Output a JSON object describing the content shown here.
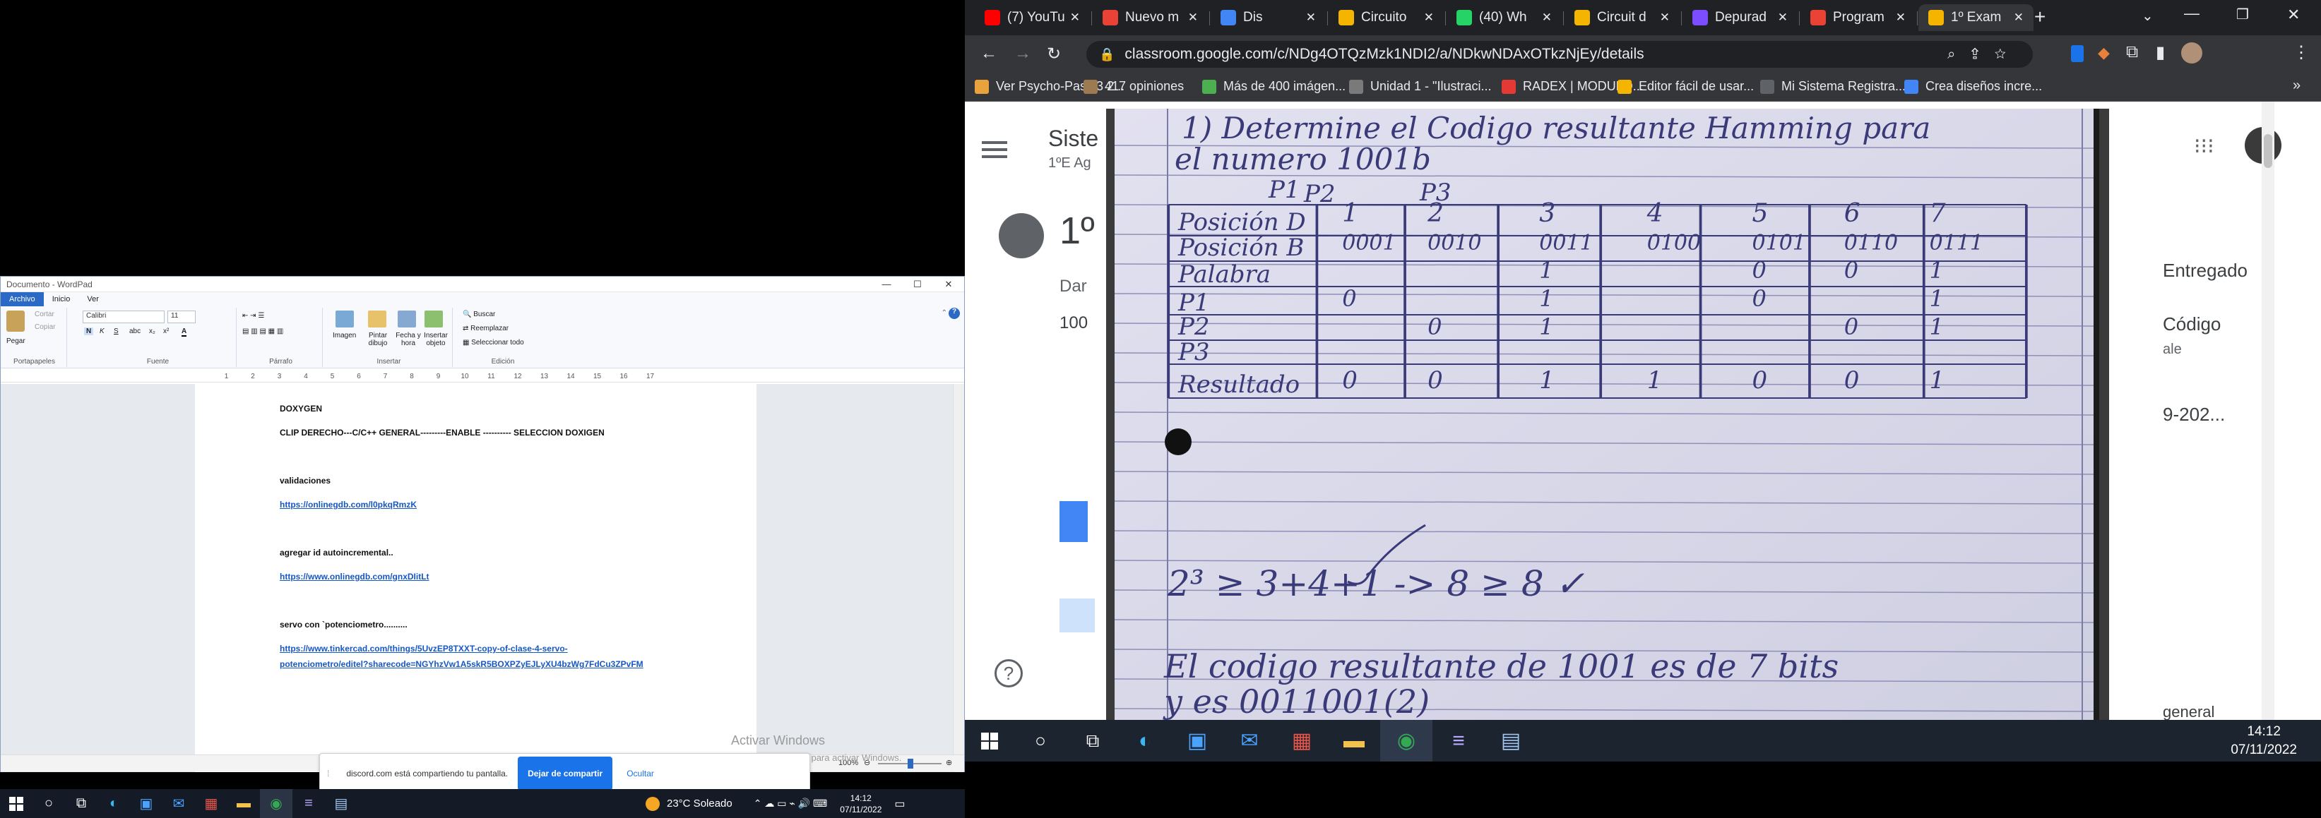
{
  "wordpad": {
    "title": "Documento - WordPad",
    "tabs": [
      "Archivo",
      "Inicio",
      "Ver"
    ],
    "ribbon": {
      "paste": "Pegar",
      "cut": "Cortar",
      "copy": "Copiar",
      "group_clipboard": "Portapapeles",
      "font_name": "Calibri",
      "font_size": "11",
      "group_font": "Fuente",
      "group_paragraph": "Párrafo",
      "image": "Imagen",
      "paint": "Pintar dibujo",
      "datetime": "Fecha y hora",
      "insert_object": "Insertar objeto",
      "group_insert": "Insertar",
      "find": "Buscar",
      "replace": "Reemplazar",
      "select_all": "Seleccionar todo",
      "group_edit": "Edición"
    },
    "ruler_numbers": [
      "1",
      "2",
      "3",
      "4",
      "5",
      "6",
      "7",
      "8",
      "9",
      "10",
      "11",
      "12",
      "13",
      "14",
      "15",
      "16",
      "17"
    ],
    "doc": {
      "l1": "DOXYGEN",
      "l2": "CLIP DERECHO---C/C++ GENERAL---------ENABLE    ----------  SELECCION DOXIGEN",
      "l3": "validaciones",
      "l4": "https://onlinegdb.com/l0pkqRmzK",
      "l5": "agregar id autoincremental..",
      "l6": "https://www.onlinegdb.com/gnxDIitLt",
      "l7": "servo con `potenciometro..........",
      "l8": "https://www.tinkercad.com/things/5UvzEP8TXXT-copy-of-clase-4-servo-",
      "l9": "potenciometro/editel?sharecode=NGYhzVw1A5skR5BOXPZyEJLyXU4bzWg7FdCu3ZPvFM"
    },
    "zoom": "100%"
  },
  "share_bar": {
    "text": "discord.com está compartiendo tu pantalla.",
    "stop": "Dejar de compartir",
    "hide": "Ocultar"
  },
  "activate": {
    "title": "Activar Windows",
    "sub": "Ve a Configuración para activar Windows."
  },
  "taskbar_left": {
    "weather": "23°C  Soleado",
    "time": "14:12",
    "date": "07/11/2022"
  },
  "chrome": {
    "tabs": [
      {
        "label": "(7) YouTu",
        "color": "#ff0000"
      },
      {
        "label": "Nuevo m",
        "color": "#ea4335"
      },
      {
        "label": "Dis",
        "color": "#4285f4"
      },
      {
        "label": "Circuito",
        "color": "#f4b400"
      },
      {
        "label": "(40) Wh",
        "color": "#25d366"
      },
      {
        "label": "Circuit d",
        "color": "#f4b400"
      },
      {
        "label": "Depurad",
        "color": "#7c4dff"
      },
      {
        "label": "Program",
        "color": "#ea4335"
      },
      {
        "label": "1º Exam",
        "color": "#f4b400"
      }
    ],
    "url": "classroom.google.com/c/NDg4OTQzMzk1NDI2/a/NDkwNDAxOTkzNjEy/details",
    "bookmarks": [
      "Ver Psycho-Pass 3 2...",
      "417 opiniones",
      "Más de 400 imágen...",
      "Unidad 1 - \"Ilustraci...",
      "RADEX | MODULO...",
      "Editor fácil de usar...",
      "Mi Sistema Registra...",
      "Crea diseños incre..."
    ]
  },
  "classroom_bg": {
    "left_title": "Siste",
    "left_sub": "1ºE Ag",
    "num": "1º",
    "dar": "Dar",
    "cien": "100",
    "entregado": "Entregado",
    "codigo": "Código",
    "ale": "ale",
    "year": "9-202...",
    "general": "general"
  },
  "sheet": {
    "title_line1": "1) Determine el Codigo resultante Hamming para",
    "title_line2": "el numero 1001b",
    "p1": "P1",
    "p2": "P2",
    "p3": "P3",
    "row_labels": [
      "Posición D",
      "Posición B",
      "Palabra",
      "P1",
      "P2",
      "P3",
      "Resultado"
    ],
    "posD": [
      "1",
      "2",
      "3",
      "4",
      "5",
      "6",
      "7"
    ],
    "posB": [
      "0001",
      "0010",
      "0011",
      "0100",
      "0101",
      "0110",
      "0111"
    ],
    "palabra": [
      "",
      "",
      "1",
      "",
      "0",
      "0",
      "1"
    ],
    "p1row": [
      "0",
      "",
      "1",
      "",
      "0",
      "",
      "1"
    ],
    "p2row": [
      "",
      "0",
      "1",
      "",
      "",
      "0",
      "1"
    ],
    "resultado": [
      "0",
      "0",
      "1",
      "1",
      "0",
      "0",
      "1"
    ],
    "formula": "2³ ≥ 3+4+1 -> 8 ≥ 8 ✓",
    "concl1": "El codigo resultante de 1001 es de 7 bits",
    "concl2": "y es 0011001(2)"
  },
  "taskbar_right": {
    "time": "14:12",
    "date": "07/11/2022"
  }
}
